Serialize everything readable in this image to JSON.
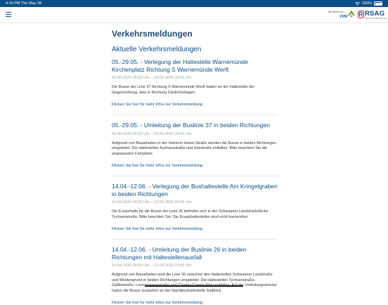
{
  "status_bar": {
    "time": "4:19 PM",
    "date": "Thu May 28",
    "battery": "100%"
  },
  "header": {
    "vvw_tagline": "Wir fahren im",
    "vvw_name": "VVW",
    "brand_name": "RSAG",
    "brand_sub": "Rostocker Straßenbahn AG"
  },
  "page": {
    "title": "Verkehrsmeldungen",
    "section_title": "Aktuelle Verkehrsmeldungen"
  },
  "messages": [
    {
      "title": "05.-29.05. - Verlegung der Haltestelle Warnemünde Kirchenplatz Richtung S Warnemünde Werft",
      "date": "05-05-2020 05:00 Uhr – 29-05-2020 20:00 Uhr",
      "body": "Die Busse der Linie 37 Richtung S Warnemünde Werft halten an der Haltestelle der Gegenrichtung, also in Richtung Diedrichshagen.",
      "link": "Klicken Sie hier für mehr Infos zur Verkehrsmeldung"
    },
    {
      "title": "05.-29.05. - Umleitung der Buslinie 37 in beiden Richtungen",
      "date": "05-05-2020 05:00 Uhr – 29-05-2020 20:00 Uhr",
      "body": "Aufgrund von Bauarbeiten in der Heinrich-Heine-Straße werden die Busse in beiden Richtungen umgeleitet. Die Haltestellen Kurhausstraße und Seestraße entfallen. Bitte beachten Sie die angepassten Fahrpläne.",
      "link": "Klicken Sie hier für mehr Infos zur Verkehrsmeldung"
    },
    {
      "title": "14.04.-12.06. - Verlegung der Bushaltestelle Am Kringelgraben in beiden Richtungen",
      "date": "14-04-2020 04:00 Uhr – 12-06-2020 23:59 Uhr",
      "body": "Die Ersatzhalte für die Busse der Linie 26 befinden sich in der Schwaaner Landstraße/Ecke Tychsenstraße. Bitte beachten Sie: Die Ersatzhaltestellen sind nicht barrierefrei.",
      "link": "Klicken Sie hier für mehr Infos zur Verkehrsmeldung"
    },
    {
      "title": "14.04.-12.06. - Umleitung der Buslinie 26 in beiden Richtungen mit Haltestellenausfall",
      "date": "14-04-2020 04:00 Uhr – 12-06-2020 23:59 Uhr",
      "body": "Aufgrund von Bauarbeiten wird die Linie 26 zwischen den Haltestellen Schwaaner Landstraße und Weidengrund in beiden Richtungen umgeleitet. Die Haltestellen Tychsenstraße, Gallleistraße, Lomonossowstraße und Charles-Darwin-Ring entfallen. Auf der Umleitungsstrecke halten die Busse zusätzlich an der Nachtbushaltestelle Südblick.",
      "link": "Klicken Sie hier für mehr Infos zur Verkehrsmeldung"
    }
  ],
  "colors": {
    "status_bar": "#0b4f88",
    "heading": "#1d4a76",
    "accent": "#0b4f88",
    "date": "#9aa0a6",
    "body_text": "#333333"
  },
  "icons": [
    "wifi-icon",
    "battery-icon",
    "menu-icon",
    "vvw-logo-icon",
    "rsag-logo-icon"
  ]
}
